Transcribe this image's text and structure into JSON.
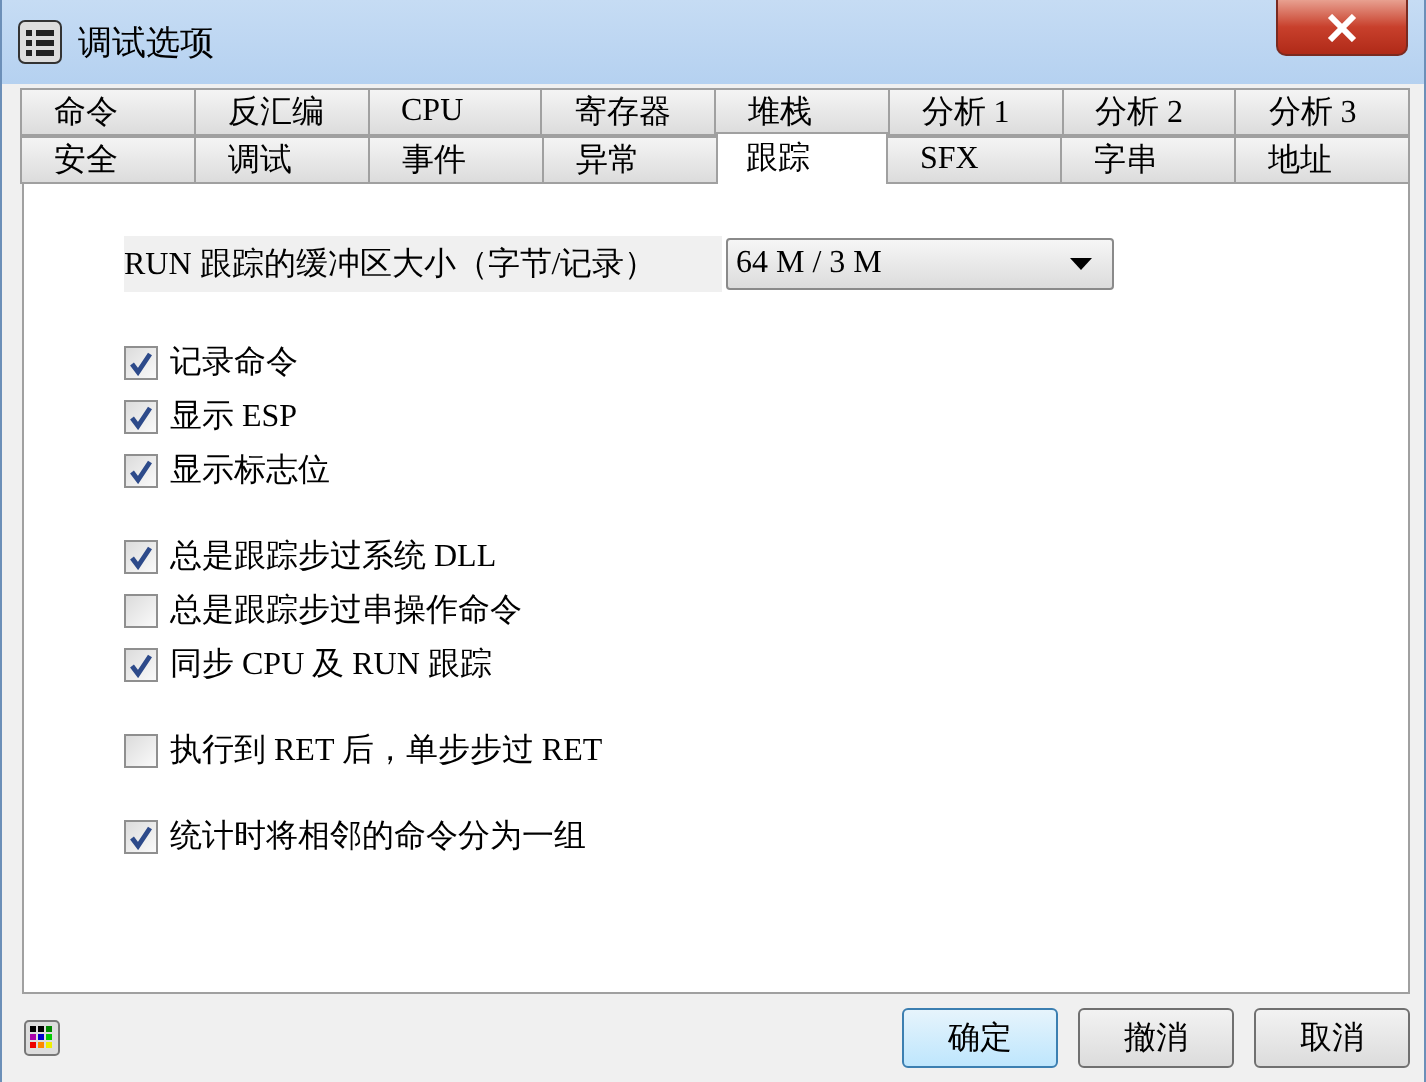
{
  "window": {
    "title": "调试选项"
  },
  "tab_rows": [
    [
      {
        "label": "命令",
        "selected": false
      },
      {
        "label": "反汇编",
        "selected": false
      },
      {
        "label": "CPU",
        "selected": false
      },
      {
        "label": "寄存器",
        "selected": false
      },
      {
        "label": "堆栈",
        "selected": false
      },
      {
        "label": "分析 1",
        "selected": false
      },
      {
        "label": "分析 2",
        "selected": false
      },
      {
        "label": "分析 3",
        "selected": false
      }
    ],
    [
      {
        "label": "安全",
        "selected": false
      },
      {
        "label": "调试",
        "selected": false
      },
      {
        "label": "事件",
        "selected": false
      },
      {
        "label": "异常",
        "selected": false
      },
      {
        "label": "跟踪",
        "selected": true
      },
      {
        "label": "SFX",
        "selected": false
      },
      {
        "label": "字串",
        "selected": false
      },
      {
        "label": "地址",
        "selected": false
      }
    ]
  ],
  "buffer": {
    "label": "RUN 跟踪的缓冲区大小（字节/记录）",
    "value": "64 M / 3 M"
  },
  "groups": [
    [
      {
        "label": "记录命令",
        "checked": true
      },
      {
        "label": "显示 ESP",
        "checked": true
      },
      {
        "label": "显示标志位",
        "checked": true
      }
    ],
    [
      {
        "label": "总是跟踪步过系统 DLL",
        "checked": true
      },
      {
        "label": "总是跟踪步过串操作命令",
        "checked": false
      },
      {
        "label": "同步 CPU 及 RUN 跟踪",
        "checked": true
      }
    ],
    [
      {
        "label": "执行到 RET 后，单步步过 RET",
        "checked": false
      }
    ],
    [
      {
        "label": "统计时将相邻的命令分为一组",
        "checked": true
      }
    ]
  ],
  "buttons": [
    {
      "label": "确定",
      "selected": true
    },
    {
      "label": "撤消",
      "selected": false
    },
    {
      "label": "取消",
      "selected": false
    }
  ]
}
